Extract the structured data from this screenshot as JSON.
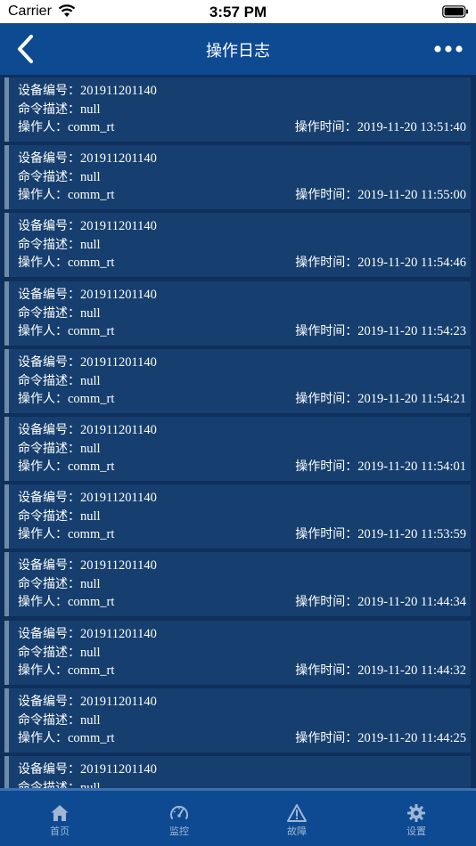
{
  "status_bar": {
    "carrier": "Carrier",
    "time": "3:57 PM"
  },
  "nav": {
    "title": "操作日志"
  },
  "labels": {
    "device_no": "设备编号：",
    "command_desc": "命令描述：",
    "operator": "操作人：",
    "op_time": "操作时间："
  },
  "logs": [
    {
      "device_no": "201911201140",
      "command_desc": "null",
      "operator": "comm_rt",
      "time": "2019-11-20 13:51:40"
    },
    {
      "device_no": "201911201140",
      "command_desc": "null",
      "operator": "comm_rt",
      "time": "2019-11-20 11:55:00"
    },
    {
      "device_no": "201911201140",
      "command_desc": "null",
      "operator": "comm_rt",
      "time": "2019-11-20 11:54:46"
    },
    {
      "device_no": "201911201140",
      "command_desc": "null",
      "operator": "comm_rt",
      "time": "2019-11-20 11:54:23"
    },
    {
      "device_no": "201911201140",
      "command_desc": "null",
      "operator": "comm_rt",
      "time": "2019-11-20 11:54:21"
    },
    {
      "device_no": "201911201140",
      "command_desc": "null",
      "operator": "comm_rt",
      "time": "2019-11-20 11:54:01"
    },
    {
      "device_no": "201911201140",
      "command_desc": "null",
      "operator": "comm_rt",
      "time": "2019-11-20 11:53:59"
    },
    {
      "device_no": "201911201140",
      "command_desc": "null",
      "operator": "comm_rt",
      "time": "2019-11-20 11:44:34"
    },
    {
      "device_no": "201911201140",
      "command_desc": "null",
      "operator": "comm_rt",
      "time": "2019-11-20 11:44:32"
    },
    {
      "device_no": "201911201140",
      "command_desc": "null",
      "operator": "comm_rt",
      "time": "2019-11-20 11:44:25"
    },
    {
      "device_no": "201911201140",
      "command_desc": "null"
    }
  ],
  "tabs": [
    {
      "label": "首页",
      "icon": "home-icon"
    },
    {
      "label": "监控",
      "icon": "gauge-icon"
    },
    {
      "label": "故障",
      "icon": "warning-icon"
    },
    {
      "label": "设置",
      "icon": "gear-icon"
    }
  ],
  "colors": {
    "nav_bg": "#0d4a92",
    "list_bg": "#0f2f5c",
    "card_bg": "#163f6f",
    "card_accent": "#6e8aa9",
    "tab_text": "#9fb6d6"
  }
}
